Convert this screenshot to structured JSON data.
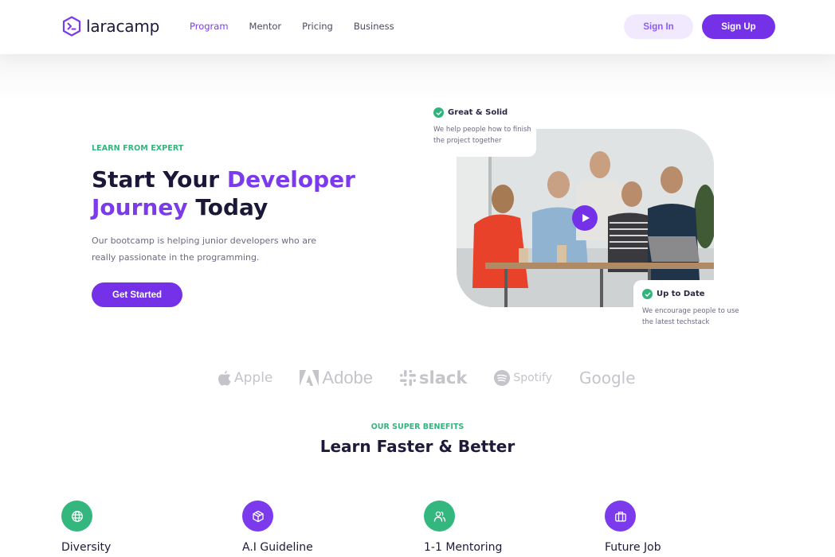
{
  "navbar": {
    "brand": "laracamp",
    "links": [
      {
        "label": "Program",
        "active": true
      },
      {
        "label": "Mentor",
        "active": false
      },
      {
        "label": "Pricing",
        "active": false
      },
      {
        "label": "Business",
        "active": false
      }
    ],
    "sign_in": "Sign In",
    "sign_up": "Sign Up"
  },
  "hero": {
    "eyebrow": "LEARN FROM EXPERT",
    "title_part1": "Start Your ",
    "title_accent1": "Developer",
    "title_accent2": "Journey",
    "title_part2": " Today",
    "description": "Our bootcamp is helping junior developers who are really passionate in the programming.",
    "cta": "Get Started",
    "card_top": {
      "title": "Great & Solid",
      "text": "We help people how to finish the project together"
    },
    "card_bottom": {
      "title": "Up to Date",
      "text": "We encourage people to use the latest techstack"
    }
  },
  "brands": [
    "Apple",
    "Adobe",
    "slack",
    "Spotify",
    "Google"
  ],
  "benefits": {
    "eyebrow": "OUR SUPER BENEFITS",
    "title": "Learn Faster & Better",
    "items": [
      {
        "label": "Diversity",
        "icon": "globe-icon",
        "color": "#34b67f"
      },
      {
        "label": "A.I Guideline",
        "icon": "cube-icon",
        "color": "#7c3aed"
      },
      {
        "label": "1-1 Mentoring",
        "icon": "users-icon",
        "color": "#34b67f"
      },
      {
        "label": "Future Job",
        "icon": "briefcase-icon",
        "color": "#7c3aed"
      }
    ]
  },
  "colors": {
    "primary": "#7431e8",
    "accent_green": "#35b37e",
    "text_dark": "#1e1b3a"
  }
}
